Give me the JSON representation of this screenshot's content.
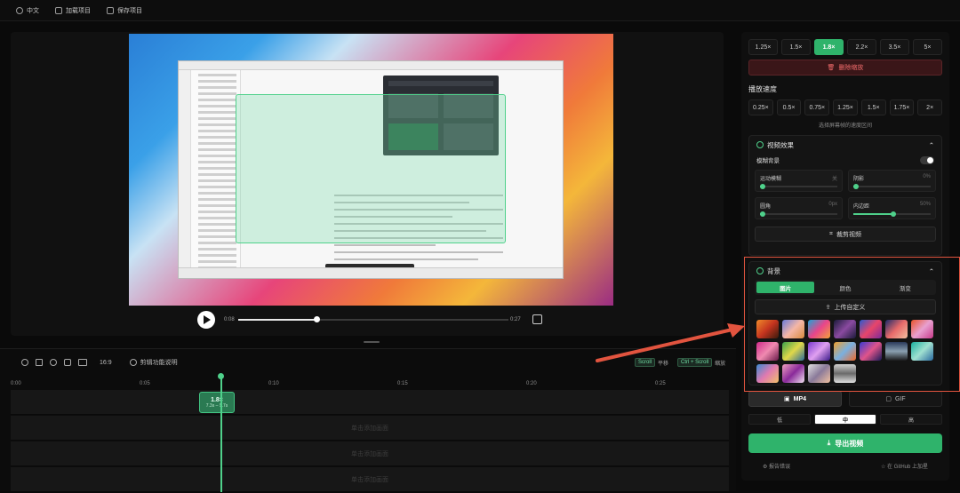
{
  "topbar": {
    "lang": "中文",
    "load": "加载项目",
    "save": "保存项目"
  },
  "player": {
    "current": "0:08",
    "total": "0:27"
  },
  "timeline": {
    "ratio": "16:9",
    "help": "剪辑功能说明",
    "kbd1_key": "Scroll",
    "kbd1_label": "平移",
    "kbd2_key": "Ctrl + Scroll",
    "kbd2_label": "缩放",
    "ruler": [
      "0:00",
      "0:05",
      "0:10",
      "0:15",
      "0:20",
      "0:25"
    ],
    "segment_label": "1.8×",
    "segment_range": "7.3s – 9.7s",
    "rows": [
      "",
      "单击添加画面",
      "单击添加画面",
      "单击添加画面"
    ]
  },
  "panel": {
    "zoom_levels": [
      "1.25×",
      "1.5×",
      "1.8×",
      "2.2×",
      "3.5×",
      "5×"
    ],
    "zoom_selected": 2,
    "delete": "删除缩放",
    "speed_title": "播放速度",
    "speeds": [
      "0.25×",
      "0.5×",
      "0.75×",
      "1.25×",
      "1.5×",
      "1.75×",
      "2×"
    ],
    "speed_hint": "选择屏幕帧的速度区间",
    "effects_title": "视频效果",
    "motion_blur": "模糊背景",
    "sliders": [
      {
        "label": "运动模糊",
        "value": "关",
        "pct": 0.04
      },
      {
        "label": "阴影",
        "value": "0%",
        "pct": 0.04
      },
      {
        "label": "圆角",
        "value": "0px",
        "pct": 0.04
      },
      {
        "label": "内边距",
        "value": "50%",
        "pct": 0.5
      }
    ],
    "crop": "裁剪视频",
    "bg_title": "背景",
    "bg_tabs": [
      "图片",
      "颜色",
      "渐变"
    ],
    "upload": "上传自定义",
    "fmt_mp4": "MP4",
    "fmt_gif": "GIF",
    "quality": [
      "低",
      "中",
      "高"
    ],
    "quality_selected": 1,
    "export": "导出视频",
    "report": "报告错误",
    "github": "在 GitHub 上加星"
  }
}
